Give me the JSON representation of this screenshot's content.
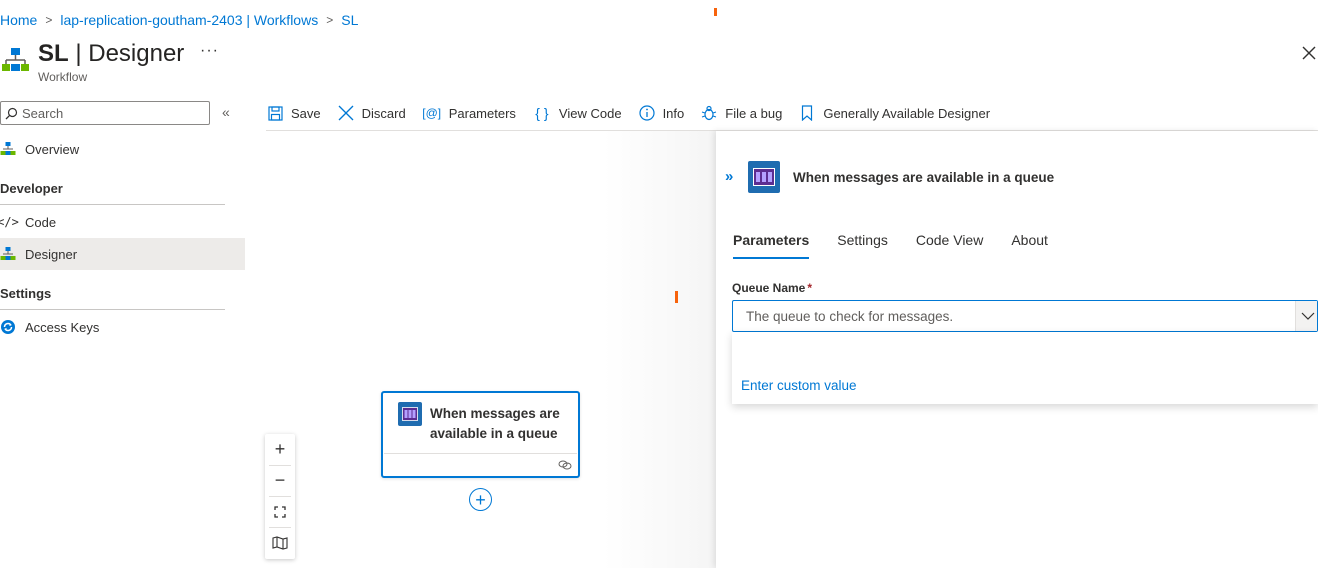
{
  "breadcrumb": {
    "items": [
      "Home",
      "lap-replication-goutham-2403 | Workflows",
      "SL"
    ]
  },
  "header": {
    "title_name": "SL",
    "title_sep": " | ",
    "title_page": "Designer",
    "more_label": "···",
    "subtitle": "Workflow",
    "close_icon": "close-icon"
  },
  "sidebar": {
    "search_placeholder": "Search",
    "collapse_label": "«",
    "items": [
      {
        "label": "Overview",
        "icon": "workflow-icon"
      },
      {
        "group": "Developer"
      },
      {
        "label": "Code",
        "icon": "code-icon"
      },
      {
        "label": "Designer",
        "icon": "workflow-icon",
        "selected": true
      },
      {
        "group": "Settings"
      },
      {
        "label": "Access Keys",
        "icon": "sync-icon"
      }
    ],
    "overview_label": "Overview",
    "developer_group": "Developer",
    "code_label": "Code",
    "designer_label": "Designer",
    "settings_group": "Settings",
    "access_keys_label": "Access Keys"
  },
  "toolbar": {
    "save_label": "Save",
    "discard_label": "Discard",
    "parameters_label": "Parameters",
    "view_code_label": "View Code",
    "info_label": "Info",
    "file_bug_label": "File a bug",
    "ga_designer_label": "Generally Available Designer"
  },
  "canvas": {
    "node": {
      "title": "When messages are available in a queue",
      "icon": "storage-queue-icon"
    },
    "zoom_in_label": "+",
    "zoom_out_label": "−",
    "fit_icon": "fit-view-icon",
    "minimap_icon": "map-icon",
    "add_step_label": "+"
  },
  "panel": {
    "title": "When messages are available in a queue",
    "collapse_label": "»",
    "tabs": [
      {
        "label": "Parameters",
        "active": true
      },
      {
        "label": "Settings"
      },
      {
        "label": "Code View"
      },
      {
        "label": "About"
      }
    ],
    "field_label": "Queue Name",
    "required_marker": "*",
    "field_placeholder": "The queue to check for messages.",
    "custom_value_label": "Enter custom value"
  },
  "colors": {
    "accent": "#0078d4",
    "marker_orange": "#f7630c",
    "required_red": "#a4262c",
    "selected_bg": "#edebe9"
  }
}
